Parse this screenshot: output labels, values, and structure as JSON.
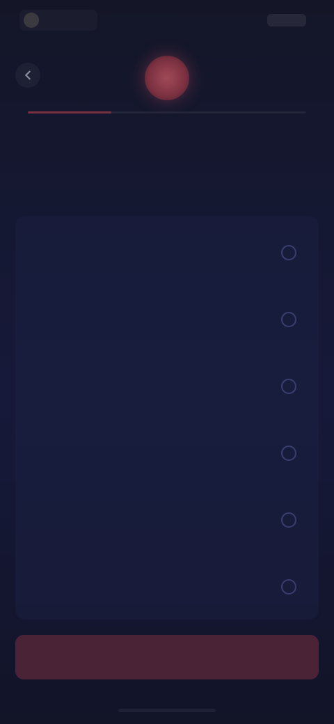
{
  "status_bar": {
    "time": "",
    "right_label": ""
  },
  "header": {
    "back_icon": "chevron-left-icon",
    "progress": 0.3,
    "accent_color": "#7a3040"
  },
  "question": {
    "text": ""
  },
  "options": [
    {
      "label": ""
    },
    {
      "label": ""
    },
    {
      "label": ""
    },
    {
      "label": ""
    },
    {
      "label": ""
    },
    {
      "label": ""
    }
  ],
  "footer": {
    "continue_label": ""
  }
}
